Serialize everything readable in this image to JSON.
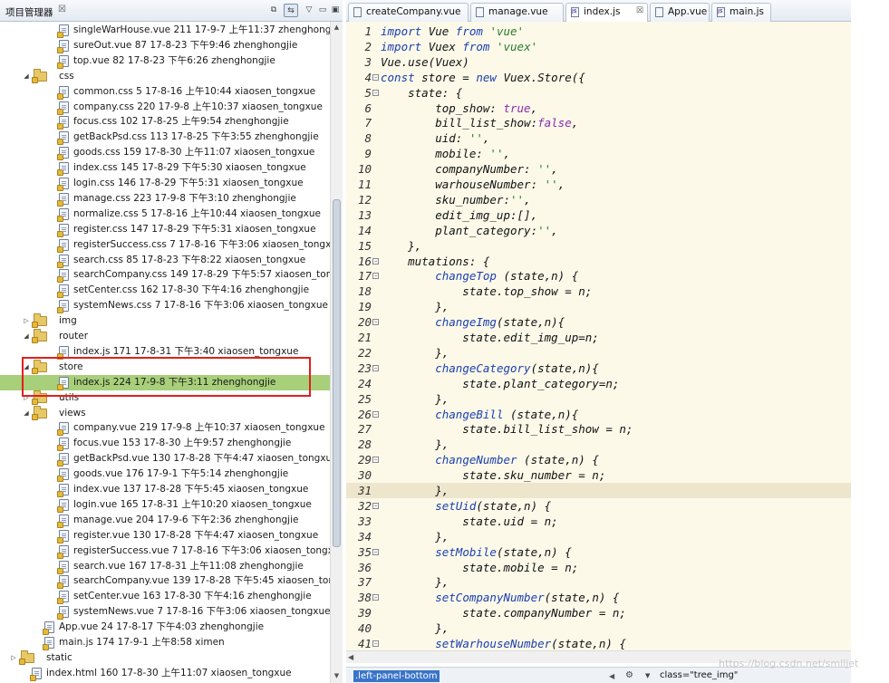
{
  "explorer": {
    "title": "项目管理器",
    "close": "☒",
    "rows": [
      {
        "indent": 3,
        "kind": "file",
        "label": "singleWarHouse.vue 211  17-9-7 上午11:37  zhenghongjie"
      },
      {
        "indent": 3,
        "kind": "file",
        "label": "sureOut.vue 87  17-8-23 下午9:46  zhenghongjie"
      },
      {
        "indent": 3,
        "kind": "file",
        "label": "top.vue 82  17-8-23 下午6:26  zhenghongjie"
      },
      {
        "indent": 2,
        "kind": "folder",
        "open": true,
        "label": "css"
      },
      {
        "indent": 3,
        "kind": "file",
        "label": "common.css 5  17-8-16 上午10:44  xiaosen_tongxue"
      },
      {
        "indent": 3,
        "kind": "file",
        "label": "company.css 220  17-9-8 上午10:37  xiaosen_tongxue"
      },
      {
        "indent": 3,
        "kind": "file",
        "label": "focus.css 102  17-8-25 上午9:54  zhenghongjie"
      },
      {
        "indent": 3,
        "kind": "file",
        "label": "getBackPsd.css 113  17-8-25 下午3:55  zhenghongjie"
      },
      {
        "indent": 3,
        "kind": "file",
        "label": "goods.css 159  17-8-30 上午11:07  xiaosen_tongxue"
      },
      {
        "indent": 3,
        "kind": "file",
        "label": "index.css 145  17-8-29 下午5:30  xiaosen_tongxue"
      },
      {
        "indent": 3,
        "kind": "file",
        "label": "login.css 146  17-8-29 下午5:31  xiaosen_tongxue"
      },
      {
        "indent": 3,
        "kind": "file",
        "label": "manage.css 223  17-9-8 下午3:10  zhenghongjie"
      },
      {
        "indent": 3,
        "kind": "file",
        "label": "normalize.css 5  17-8-16 上午10:44  xiaosen_tongxue"
      },
      {
        "indent": 3,
        "kind": "file",
        "label": "register.css 147  17-8-29 下午5:31  xiaosen_tongxue"
      },
      {
        "indent": 3,
        "kind": "file",
        "label": "registerSuccess.css 7  17-8-16 下午3:06  xiaosen_tongxue"
      },
      {
        "indent": 3,
        "kind": "file",
        "label": "search.css 85  17-8-23 下午8:22  xiaosen_tongxue"
      },
      {
        "indent": 3,
        "kind": "file",
        "label": "searchCompany.css 149  17-8-29 下午5:57  xiaosen_tongx"
      },
      {
        "indent": 3,
        "kind": "file",
        "label": "setCenter.css 162  17-8-30 下午4:16  zhenghongjie"
      },
      {
        "indent": 3,
        "kind": "file",
        "label": "systemNews.css 7  17-8-16 下午3:06  xiaosen_tongxue"
      },
      {
        "indent": 2,
        "kind": "folder",
        "open": false,
        "label": "img"
      },
      {
        "indent": 2,
        "kind": "folder",
        "open": true,
        "label": "router"
      },
      {
        "indent": 3,
        "kind": "file",
        "label": "index.js 171  17-8-31 下午3:40  xiaosen_tongxue"
      },
      {
        "indent": 2,
        "kind": "folder",
        "open": true,
        "label": "store"
      },
      {
        "indent": 3,
        "kind": "file",
        "selected": true,
        "label": "index.js 224  17-9-8 下午3:11  zhenghongjie"
      },
      {
        "indent": 2,
        "kind": "folder",
        "open": false,
        "label": "utils"
      },
      {
        "indent": 2,
        "kind": "folder",
        "open": true,
        "label": "views"
      },
      {
        "indent": 3,
        "kind": "file",
        "label": "company.vue 219  17-9-8 上午10:37  xiaosen_tongxue"
      },
      {
        "indent": 3,
        "kind": "file",
        "label": "focus.vue 153  17-8-30 上午9:57  zhenghongjie"
      },
      {
        "indent": 3,
        "kind": "file",
        "label": "getBackPsd.vue 130  17-8-28 下午4:47  xiaosen_tongxue"
      },
      {
        "indent": 3,
        "kind": "file",
        "label": "goods.vue 176  17-9-1 下午5:14  zhenghongjie"
      },
      {
        "indent": 3,
        "kind": "file",
        "label": "index.vue 137  17-8-28 下午5:45  xiaosen_tongxue"
      },
      {
        "indent": 3,
        "kind": "file",
        "label": "login.vue 165  17-8-31 上午10:20  xiaosen_tongxue"
      },
      {
        "indent": 3,
        "kind": "file",
        "label": "manage.vue 204  17-9-6 下午2:36  zhenghongjie"
      },
      {
        "indent": 3,
        "kind": "file",
        "label": "register.vue 130  17-8-28 下午4:47  xiaosen_tongxue"
      },
      {
        "indent": 3,
        "kind": "file",
        "label": "registerSuccess.vue 7  17-8-16 下午3:06  xiaosen_tongxue"
      },
      {
        "indent": 3,
        "kind": "file",
        "label": "search.vue 167  17-8-31 上午11:08  zhenghongjie"
      },
      {
        "indent": 3,
        "kind": "file",
        "label": "searchCompany.vue 139  17-8-28 下午5:45  xiaosen_tongx"
      },
      {
        "indent": 3,
        "kind": "file",
        "label": "setCenter.vue 163  17-8-30 下午4:16  zhenghongjie"
      },
      {
        "indent": 3,
        "kind": "file",
        "label": "systemNews.vue 7  17-8-16 下午3:06  xiaosen_tongxue"
      },
      {
        "indent": 2,
        "kind": "file",
        "label": "App.vue 24  17-8-17 下午4:03  zhenghongjie"
      },
      {
        "indent": 2,
        "kind": "file",
        "label": "main.js 174  17-9-1 上午8:58  ximen"
      },
      {
        "indent": 1,
        "kind": "folder",
        "open": false,
        "label": "static"
      },
      {
        "indent": 1,
        "kind": "file",
        "label": "index.html 160  17-8-30 上午11:07  xiaosen_tongxue"
      }
    ]
  },
  "editor": {
    "tabs": [
      {
        "label": "createCompany.vue",
        "icon": "vue",
        "active": false
      },
      {
        "label": "manage.vue",
        "icon": "vue",
        "active": false
      },
      {
        "label": "index.js",
        "icon": "js",
        "active": true,
        "close": "☒"
      },
      {
        "label": "App.vue",
        "icon": "vue",
        "active": false
      },
      {
        "label": "main.js",
        "icon": "js",
        "active": false
      }
    ],
    "current_line": 31,
    "lines": [
      {
        "n": 1,
        "fold": false,
        "tokens": [
          [
            "kw",
            "import "
          ],
          [
            "p",
            "Vue "
          ],
          [
            "kw",
            "from "
          ],
          [
            "str",
            "'vue'"
          ]
        ]
      },
      {
        "n": 2,
        "fold": false,
        "tokens": [
          [
            "kw",
            "import "
          ],
          [
            "p",
            "Vuex "
          ],
          [
            "kw",
            "from "
          ],
          [
            "str",
            "'vuex'"
          ]
        ]
      },
      {
        "n": 3,
        "fold": false,
        "tokens": [
          [
            "p",
            "Vue.use(Vuex)"
          ]
        ]
      },
      {
        "n": 4,
        "fold": true,
        "tokens": [
          [
            "kw",
            "const "
          ],
          [
            "p",
            "store = "
          ],
          [
            "kw",
            "new "
          ],
          [
            "p",
            "Vuex.Store({"
          ]
        ]
      },
      {
        "n": 5,
        "fold": true,
        "tokens": [
          [
            "p",
            "    state: {"
          ]
        ]
      },
      {
        "n": 6,
        "fold": false,
        "tokens": [
          [
            "p",
            "        top_show: "
          ],
          [
            "bool",
            "true"
          ],
          [
            "p",
            ","
          ]
        ]
      },
      {
        "n": 7,
        "fold": false,
        "tokens": [
          [
            "p",
            "        bill_list_show:"
          ],
          [
            "bool",
            "false"
          ],
          [
            "p",
            ","
          ]
        ]
      },
      {
        "n": 8,
        "fold": false,
        "tokens": [
          [
            "p",
            "        uid: "
          ],
          [
            "str",
            "''"
          ],
          [
            "p",
            ","
          ]
        ]
      },
      {
        "n": 9,
        "fold": false,
        "tokens": [
          [
            "p",
            "        mobile: "
          ],
          [
            "str",
            "''"
          ],
          [
            "p",
            ","
          ]
        ]
      },
      {
        "n": 10,
        "fold": false,
        "tokens": [
          [
            "p",
            "        companyNumber: "
          ],
          [
            "str",
            "''"
          ],
          [
            "p",
            ","
          ]
        ]
      },
      {
        "n": 11,
        "fold": false,
        "tokens": [
          [
            "p",
            "        warhouseNumber: "
          ],
          [
            "str",
            "''"
          ],
          [
            "p",
            ","
          ]
        ]
      },
      {
        "n": 12,
        "fold": false,
        "tokens": [
          [
            "p",
            "        sku_number:"
          ],
          [
            "str",
            "''"
          ],
          [
            "p",
            ","
          ]
        ]
      },
      {
        "n": 13,
        "fold": false,
        "tokens": [
          [
            "p",
            "        edit_img_up:[],"
          ]
        ]
      },
      {
        "n": 14,
        "fold": false,
        "tokens": [
          [
            "p",
            "        plant_category:"
          ],
          [
            "str",
            "''"
          ],
          [
            "p",
            ","
          ]
        ]
      },
      {
        "n": 15,
        "fold": false,
        "tokens": [
          [
            "p",
            "    },"
          ]
        ]
      },
      {
        "n": 16,
        "fold": true,
        "tokens": [
          [
            "p",
            "    mutations: {"
          ]
        ]
      },
      {
        "n": 17,
        "fold": true,
        "tokens": [
          [
            "p",
            "        "
          ],
          [
            "fn",
            "changeTop"
          ],
          [
            "p",
            " (state,n) {"
          ]
        ]
      },
      {
        "n": 18,
        "fold": false,
        "tokens": [
          [
            "p",
            "            state.top_show = n;"
          ]
        ]
      },
      {
        "n": 19,
        "fold": false,
        "tokens": [
          [
            "p",
            "        },"
          ]
        ]
      },
      {
        "n": 20,
        "fold": true,
        "tokens": [
          [
            "p",
            "        "
          ],
          [
            "fn",
            "changeImg"
          ],
          [
            "p",
            "(state,n){"
          ]
        ]
      },
      {
        "n": 21,
        "fold": false,
        "tokens": [
          [
            "p",
            "            state.edit_img_up=n;"
          ]
        ]
      },
      {
        "n": 22,
        "fold": false,
        "tokens": [
          [
            "p",
            "        },"
          ]
        ]
      },
      {
        "n": 23,
        "fold": true,
        "tokens": [
          [
            "p",
            "        "
          ],
          [
            "fn",
            "changeCategory"
          ],
          [
            "p",
            "(state,n){"
          ]
        ]
      },
      {
        "n": 24,
        "fold": false,
        "tokens": [
          [
            "p",
            "            state.plant_category=n;"
          ]
        ]
      },
      {
        "n": 25,
        "fold": false,
        "tokens": [
          [
            "p",
            "        },"
          ]
        ]
      },
      {
        "n": 26,
        "fold": true,
        "tokens": [
          [
            "p",
            "        "
          ],
          [
            "fn",
            "changeBill"
          ],
          [
            "p",
            " (state,n){"
          ]
        ]
      },
      {
        "n": 27,
        "fold": false,
        "tokens": [
          [
            "p",
            "            state.bill_list_show = n;"
          ]
        ]
      },
      {
        "n": 28,
        "fold": false,
        "tokens": [
          [
            "p",
            "        },"
          ]
        ]
      },
      {
        "n": 29,
        "fold": true,
        "tokens": [
          [
            "p",
            "        "
          ],
          [
            "fn",
            "changeNumber"
          ],
          [
            "p",
            " (state,n) {"
          ]
        ]
      },
      {
        "n": 30,
        "fold": false,
        "tokens": [
          [
            "p",
            "            state.sku_number = n;"
          ]
        ]
      },
      {
        "n": 31,
        "fold": false,
        "tokens": [
          [
            "p",
            "        },"
          ]
        ]
      },
      {
        "n": 32,
        "fold": true,
        "tokens": [
          [
            "p",
            "        "
          ],
          [
            "fn",
            "setUid"
          ],
          [
            "p",
            "(state,n) {"
          ]
        ]
      },
      {
        "n": 33,
        "fold": false,
        "tokens": [
          [
            "p",
            "            state.uid = n;"
          ]
        ]
      },
      {
        "n": 34,
        "fold": false,
        "tokens": [
          [
            "p",
            "        },"
          ]
        ]
      },
      {
        "n": 35,
        "fold": true,
        "tokens": [
          [
            "p",
            "        "
          ],
          [
            "fn",
            "setMobile"
          ],
          [
            "p",
            "(state,n) {"
          ]
        ]
      },
      {
        "n": 36,
        "fold": false,
        "tokens": [
          [
            "p",
            "            state.mobile = n;"
          ]
        ]
      },
      {
        "n": 37,
        "fold": false,
        "tokens": [
          [
            "p",
            "        },"
          ]
        ]
      },
      {
        "n": 38,
        "fold": true,
        "tokens": [
          [
            "p",
            "        "
          ],
          [
            "fn",
            "setCompanyNumber"
          ],
          [
            "p",
            "(state,n) {"
          ]
        ]
      },
      {
        "n": 39,
        "fold": false,
        "tokens": [
          [
            "p",
            "            state.companyNumber = n;"
          ]
        ]
      },
      {
        "n": 40,
        "fold": false,
        "tokens": [
          [
            "p",
            "        },"
          ]
        ]
      },
      {
        "n": 41,
        "fold": true,
        "tokens": [
          [
            "p",
            "        "
          ],
          [
            "fn",
            "setWarhouseNumber"
          ],
          [
            "p",
            "(state,n) {"
          ]
        ]
      }
    ]
  },
  "statusbar": {
    "breadcrumb": ".left-panel-bottom",
    "class_attr": "class=\"tree_img\""
  },
  "watermark": "https://blog.csdn.net/smlljet",
  "colors": {
    "selection": "#a8cf7a",
    "highlight_box": "#e02020",
    "editor_bg": "#fcf9e9",
    "current_line": "#ede6cd"
  }
}
